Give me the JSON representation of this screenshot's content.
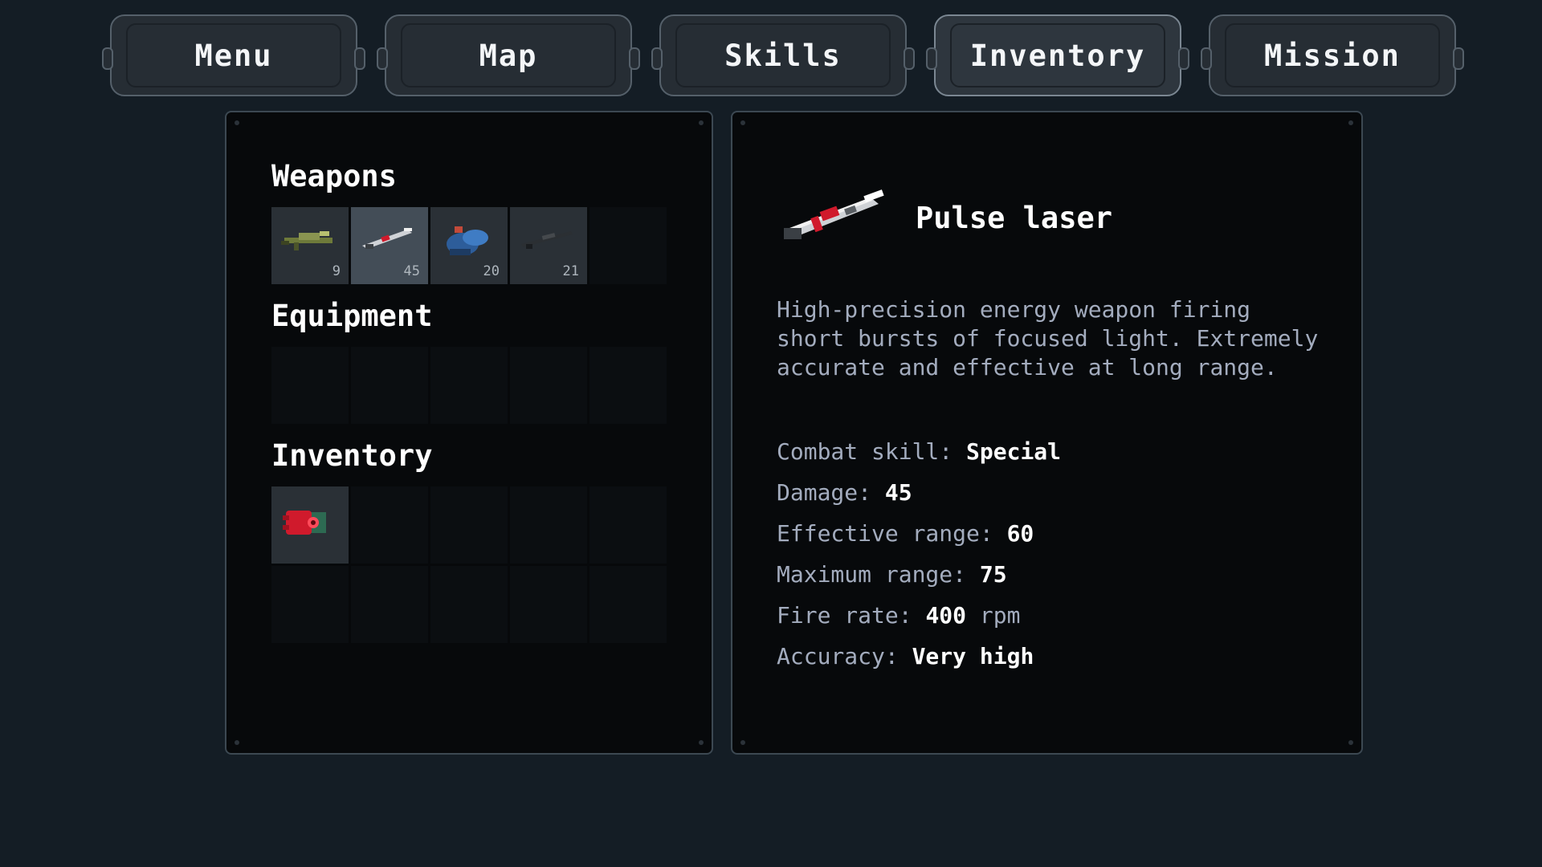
{
  "tabs": [
    {
      "label": "Menu",
      "active": false
    },
    {
      "label": "Map",
      "active": false
    },
    {
      "label": "Skills",
      "active": false
    },
    {
      "label": "Inventory",
      "active": true
    },
    {
      "label": "Mission",
      "active": false
    }
  ],
  "left_panel": {
    "weapons_title": "Weapons",
    "weapons": [
      {
        "icon": "grenade-launcher-icon",
        "count": "9",
        "selected": false
      },
      {
        "icon": "pulse-laser-icon",
        "count": "45",
        "selected": true
      },
      {
        "icon": "plasma-cannon-icon",
        "count": "20",
        "selected": false
      },
      {
        "icon": "sniper-rifle-icon",
        "count": "21",
        "selected": false
      }
    ],
    "equipment_title": "Equipment",
    "inventory_title": "Inventory",
    "inventory_items": [
      {
        "icon": "red-device-icon"
      }
    ]
  },
  "detail": {
    "icon": "pulse-laser-icon",
    "title": "Pulse laser",
    "description": "High-precision energy weapon firing short bursts of focused light. Extremely accurate and effective at long range.",
    "stats": [
      {
        "label": "Combat skill: ",
        "value": "Special"
      },
      {
        "label": "Damage: ",
        "value": "45"
      },
      {
        "label": "Effective range: ",
        "value": "60"
      },
      {
        "label": "Maximum range: ",
        "value": "75"
      },
      {
        "label": "Fire rate: ",
        "value": "400",
        "suffix": " rpm"
      },
      {
        "label": "Accuracy: ",
        "value": "Very high"
      }
    ]
  },
  "colors": {
    "background": "#141d25",
    "panel": "#07090b",
    "description_text": "#a3acbe",
    "accent_red": "#d01a2c"
  }
}
